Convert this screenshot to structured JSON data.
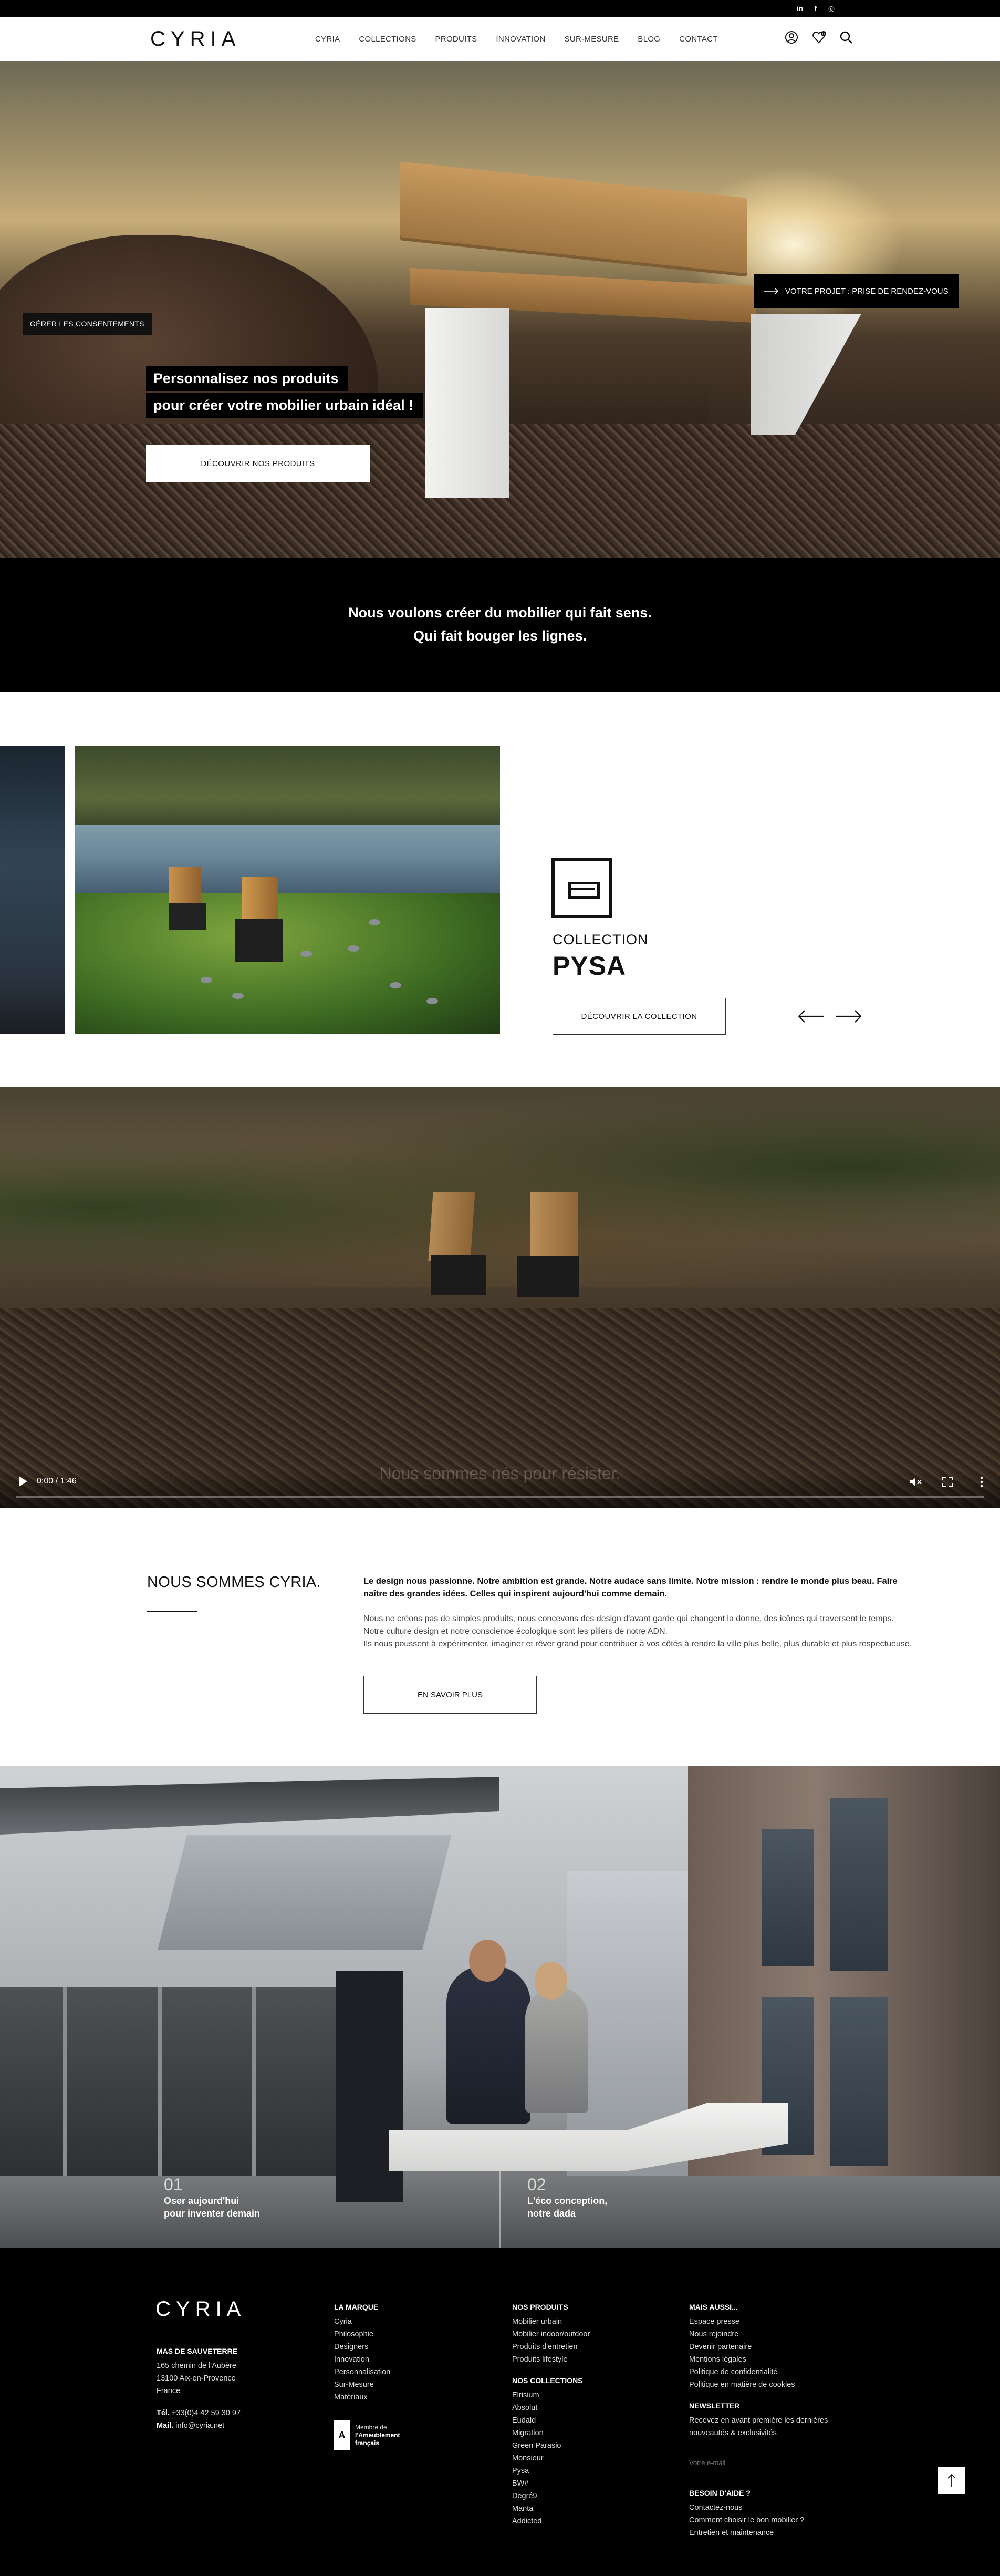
{
  "social": [
    "in",
    "f",
    "◎"
  ],
  "header": {
    "logo": "CYRIA",
    "nav": [
      "CYRIA",
      "COLLECTIONS",
      "PRODUITS",
      "INNOVATION",
      "SUR-MESURE",
      "BLOG",
      "CONTACT"
    ],
    "wishlist_count": "0"
  },
  "hero": {
    "consent_btn": "GÉRER LES CONSENTEMENTS",
    "appointment_btn": "VOTRE PROJET : PRISE DE RENDEZ-VOUS",
    "title_line1": "Personnalisez nos produits",
    "title_line2": "pour créer votre mobilier urbain idéal !",
    "cta": "DÉCOUVRIR NOS PRODUITS"
  },
  "intro": {
    "line1": "Nous voulons créer du mobilier qui fait sens.",
    "line2": "Qui fait bouger les lignes."
  },
  "collection": {
    "label": "COLLECTION",
    "name": "PYSA",
    "cta": "DÉCOUVRIR LA COLLECTION"
  },
  "video": {
    "time": "0:00 / 1:46",
    "overlay": "Nous sommes nés pour résister.",
    "progress": 0
  },
  "about": {
    "heading": "NOUS SOMMES CYRIA.",
    "lead": "Le design nous passionne. Notre ambition est grande. Notre audace sans limite. Notre mission : rendre le monde plus beau. Faire naître des grandes idées. Celles qui inspirent aujourd'hui comme demain.",
    "body1": "Nous ne créons pas de simples produits, nous concevons des design d'avant garde qui changent la donne, des icônes qui traversent le temps.",
    "body2": "Notre culture design et notre conscience écologique sont les piliers de notre ADN.",
    "body3": "Ils nous poussent à expérimenter, imaginer et rêver grand pour contribuer à vos côtés à rendre la ville plus belle, plus durable et plus respectueuse.",
    "cta": "EN SAVOIR PLUS"
  },
  "gallery": {
    "items": [
      {
        "num": "01",
        "line1": "Oser aujourd'hui",
        "line2": "pour inventer demain"
      },
      {
        "num": "02",
        "line1": "L'éco conception,",
        "line2": "notre dada"
      }
    ]
  },
  "footer": {
    "logo": "CYRIA",
    "company": "MAS DE SAUVETERRE",
    "address": [
      "165 chemin de l'Aubère",
      "13100 Aix-en-Provence",
      "France"
    ],
    "tel_label": "Tél.",
    "tel": "+33(0)4 42 59 30 97",
    "mail_label": "Mail.",
    "mail": "info@cyria.net",
    "brand_heading": "LA MARQUE",
    "brand_links": [
      "Cyria",
      "Philosophie",
      "Designers",
      "Innovation",
      "Personnalisation",
      "Sur-Mesure",
      "Matériaux"
    ],
    "badge_mark": "A",
    "badge_line1": "Membre de",
    "badge_line2": "l'Ameublement",
    "badge_line3": "français",
    "products_heading": "NOS PRODUITS",
    "products_links": [
      "Mobilier urbain",
      "Mobilier indoor/outdoor",
      "Produits d'entretien",
      "Produits lifestyle"
    ],
    "collections_heading": "NOS COLLECTIONS",
    "collections_links": [
      "Elrisium",
      "Absolut",
      "Eudald",
      "Migration",
      "Green Parasio",
      "Monsieur",
      "Pysa",
      "BW#",
      "Degré9",
      "Manta",
      "Addicted"
    ],
    "more_heading": "MAIS AUSSI...",
    "more_links": [
      "Espace presse",
      "Nous rejoindre",
      "Devenir partenaire",
      "Mentions légales",
      "Politique de confidentialité",
      "Politique en matière de cookies"
    ],
    "newsletter_heading": "NEWSLETTER",
    "newsletter_text": "Recevez en avant première les dernières nouveautés & exclusivités",
    "newsletter_placeholder": "Votre e-mail",
    "help_heading": "BESOIN D'AIDE ?",
    "help_links": [
      "Contactez-nous",
      "Comment choisir le bon mobilier ?",
      "Entretien et maintenance"
    ]
  }
}
